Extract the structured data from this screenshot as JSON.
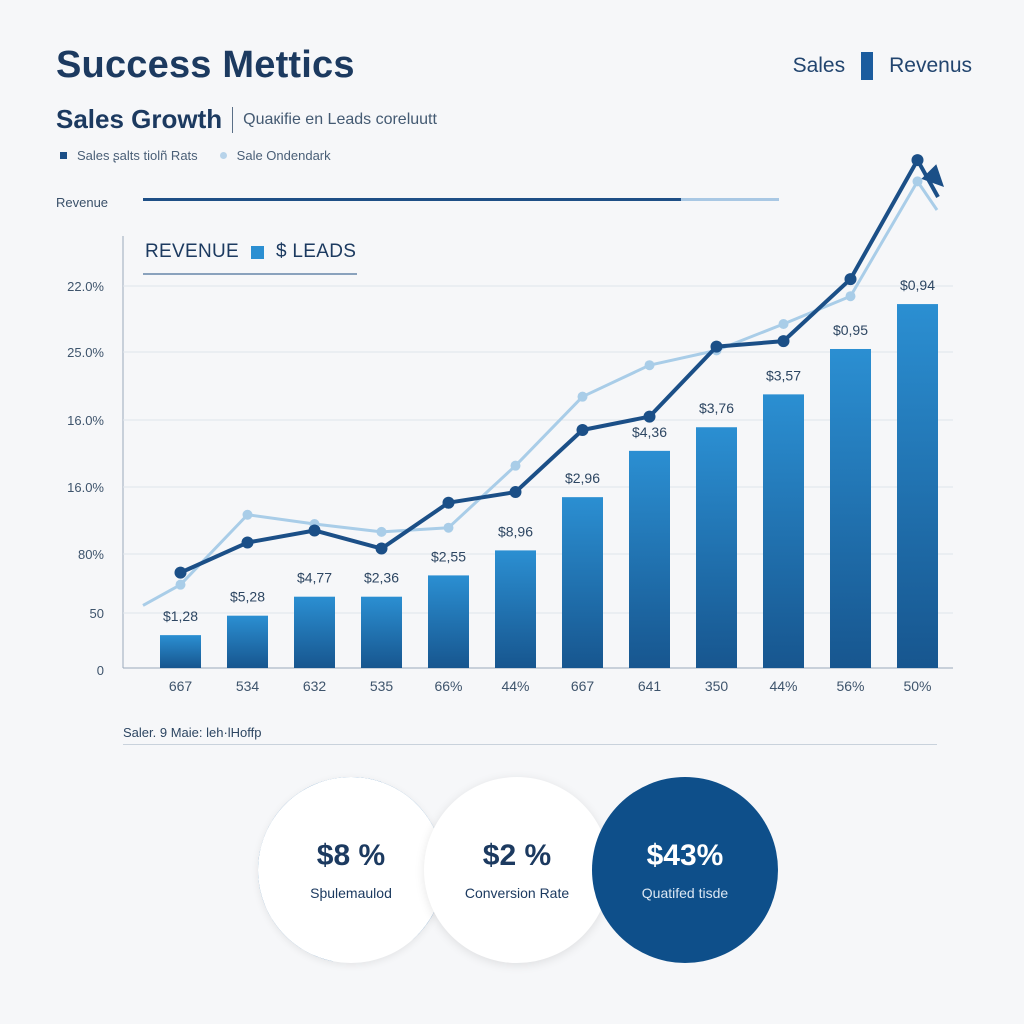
{
  "header": {
    "title": "Success Mettics",
    "legend_sales": "Sales",
    "legend_revenue": "Revenus",
    "subtitle": "Sales Growth",
    "subtitle_desc": "Quaкifie en Leads coreluutt",
    "mini_legend_1": "Sales ʂalts tiolñ Rats",
    "mini_legend_2": "Sale  Ondendark",
    "revenue_label": "Revenue"
  },
  "chart_data": {
    "type": "bar",
    "legend": {
      "label_1": "REVENUE",
      "label_2": "$ LEADS"
    },
    "y_ticks": [
      "22.0%",
      "25.0%",
      "16.0%",
      "16.0%",
      "80%",
      "50",
      "0"
    ],
    "ylim": [
      0,
      100
    ],
    "categories": [
      "667",
      "534",
      "632",
      "535",
      "66%",
      "44%",
      "667",
      "641",
      "350",
      "44%",
      "56%",
      "50%"
    ],
    "series": [
      {
        "values": [
          7.1,
          11.3,
          15.4,
          15.4,
          20.0,
          25.4,
          36.9,
          46.9,
          52.0,
          59.1,
          68.9,
          78.6
        ]
      },
      {
        "values": [
          20.6,
          27.1,
          29.7,
          25.8,
          35.7,
          38.0,
          51.4,
          54.3,
          69.4,
          70.6,
          84.0,
          109.7
        ]
      },
      {
        "values": [
          18.0,
          33.1,
          31.1,
          29.4,
          30.3,
          43.7,
          58.6,
          65.4,
          68.6,
          74.3,
          80.3,
          105.1
        ]
      }
    ],
    "data_labels": [
      "$1,28",
      "$5,28",
      "$4,77",
      "$2,36",
      "$2,55",
      "$8,96",
      "$2,96",
      "$4,36",
      "$3,76",
      "$3,57",
      "$0,95",
      "$0,94"
    ],
    "colors": {
      "bar_top": "#2b8fd2",
      "bar_bottom": "#17568f",
      "line_dark": "#1b4f87",
      "line_light": "#a9cde8"
    },
    "grid": true
  },
  "footnote": "Saler. 9 Maie: Ɩeh·lHoffp",
  "kpis": [
    {
      "value": "$8 %",
      "label": "Sþulemaulod",
      "fill_fraction": 0.85
    },
    {
      "value": "$2 %",
      "label": "Conversion Rate"
    },
    {
      "value": "$43%",
      "label": "Quatifed tisde"
    }
  ]
}
